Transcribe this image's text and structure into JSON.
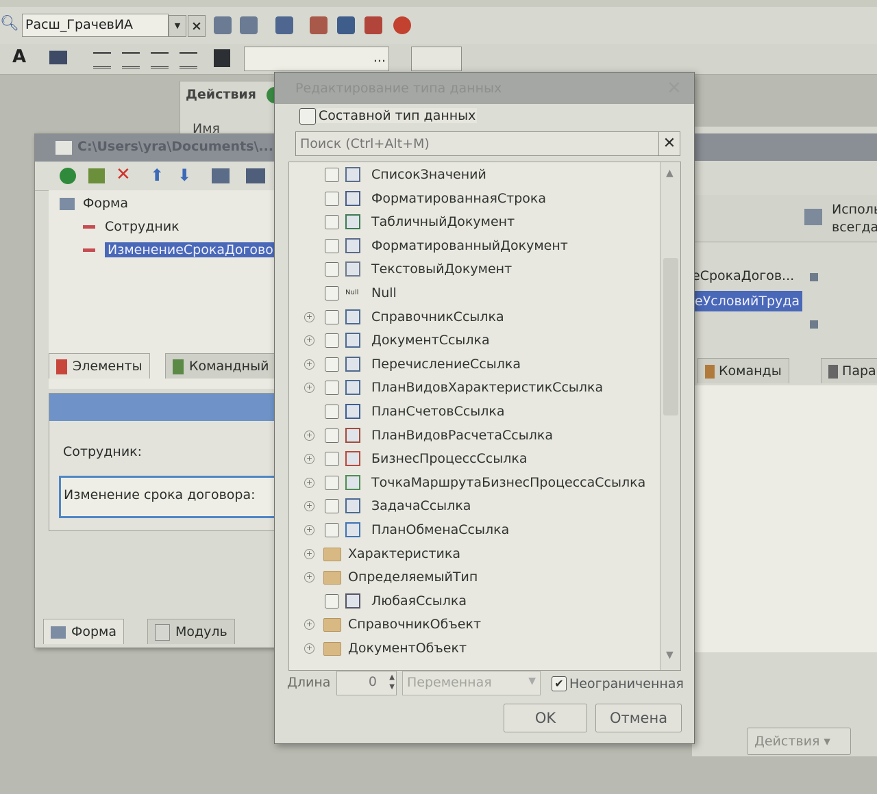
{
  "toolbar": {
    "user_combo_value": "Расш_ГрачевИА",
    "font_combo_value": "..."
  },
  "left_window": {
    "title": "C:\\Users\\yra\\Documents\\...",
    "tree": {
      "root": "Форма",
      "items": [
        "Сотрудник",
        "ИзменениеСрокаДоговора"
      ]
    },
    "tabs": [
      "Элементы",
      "Командный"
    ],
    "preview": {
      "employee_label": "Сотрудник:",
      "change_label": "Изменение срока договора:"
    },
    "bottom_tabs": [
      "Форма",
      "Модуль"
    ]
  },
  "background_panel": {
    "actions_label": "Действия",
    "name_header": "Имя"
  },
  "right_window": {
    "col_header": "Использ. всегда",
    "rows": [
      "еСрокаДогов...",
      "еУсловийТруда"
    ],
    "tabs": [
      "Команды",
      "Пара"
    ],
    "actions_button": "Действия"
  },
  "dialog": {
    "title": "Редактирование типа данных",
    "composite_label": "Составной тип данных",
    "search_placeholder": "Поиск (Ctrl+Alt+M)",
    "types": [
      {
        "label": "СписокЗначений",
        "expandable": false,
        "checkbox": true,
        "icon": "list-icon"
      },
      {
        "label": "ФорматированнаяСтрока",
        "expandable": false,
        "checkbox": true,
        "icon": "formatted-string-icon"
      },
      {
        "label": "ТабличныйДокумент",
        "expandable": false,
        "checkbox": true,
        "icon": "spreadsheet-icon"
      },
      {
        "label": "ФорматированныйДокумент",
        "expandable": false,
        "checkbox": true,
        "icon": "formatted-document-icon"
      },
      {
        "label": "ТекстовыйДокумент",
        "expandable": false,
        "checkbox": true,
        "icon": "text-document-icon"
      },
      {
        "label": "Null",
        "expandable": false,
        "checkbox": true,
        "icon": "null-icon"
      },
      {
        "label": "СправочникСсылка",
        "expandable": true,
        "checkbox": true,
        "icon": "catalog-icon"
      },
      {
        "label": "ДокументСсылка",
        "expandable": true,
        "checkbox": true,
        "icon": "document-icon"
      },
      {
        "label": "ПеречислениеСсылка",
        "expandable": true,
        "checkbox": true,
        "icon": "enum-icon"
      },
      {
        "label": "ПланВидовХарактеристикСсылка",
        "expandable": true,
        "checkbox": true,
        "icon": "chart-of-characteristics-icon"
      },
      {
        "label": "ПланСчетовСсылка",
        "expandable": false,
        "checkbox": true,
        "icon": "chart-of-accounts-icon"
      },
      {
        "label": "ПланВидовРасчетаСсылка",
        "expandable": true,
        "checkbox": true,
        "icon": "chart-of-calculation-icon"
      },
      {
        "label": "БизнесПроцессСсылка",
        "expandable": true,
        "checkbox": true,
        "icon": "business-process-icon"
      },
      {
        "label": "ТочкаМаршрутаБизнесПроцессаСсылка",
        "expandable": true,
        "checkbox": true,
        "icon": "route-point-icon"
      },
      {
        "label": "ЗадачаСсылка",
        "expandable": true,
        "checkbox": true,
        "icon": "task-icon"
      },
      {
        "label": "ПланОбменаСсылка",
        "expandable": true,
        "checkbox": true,
        "icon": "exchange-plan-icon"
      },
      {
        "label": "Характеристика",
        "expandable": true,
        "checkbox": false,
        "icon": "folder-icon"
      },
      {
        "label": "ОпределяемыйТип",
        "expandable": true,
        "checkbox": false,
        "icon": "folder-icon"
      },
      {
        "label": "ЛюбаяСсылка",
        "expandable": false,
        "checkbox": true,
        "icon": "any-ref-icon"
      },
      {
        "label": "СправочникОбъект",
        "expandable": true,
        "checkbox": false,
        "icon": "folder-icon"
      },
      {
        "label": "ДокументОбъект",
        "expandable": true,
        "checkbox": false,
        "icon": "folder-icon"
      }
    ],
    "length_label": "Длина",
    "length_value": "0",
    "variable_label": "Переменная",
    "unlimited_label": "Неограниченная",
    "unlimited_checked": true,
    "ok_label": "OK",
    "cancel_label": "Отмена"
  }
}
